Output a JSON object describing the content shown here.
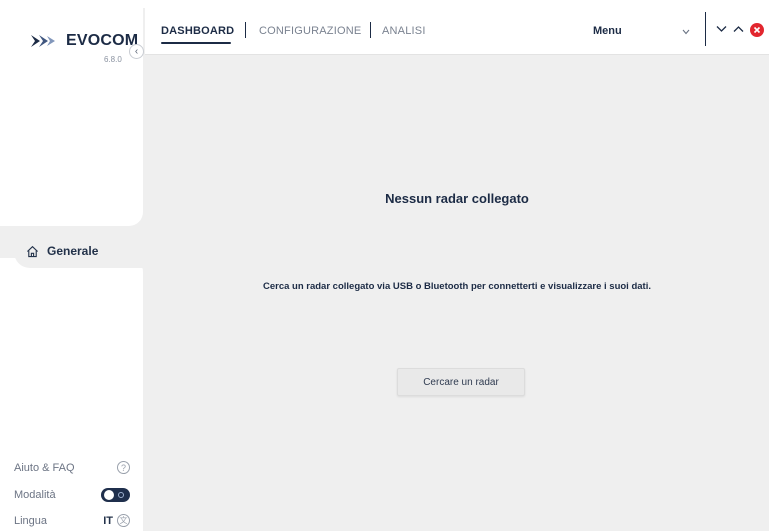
{
  "app": {
    "name": "EVOCOM",
    "version": "6.8.0"
  },
  "header": {
    "tabs": [
      {
        "label": "DASHBOARD",
        "active": true
      },
      {
        "label": "CONFIGURAZIONE",
        "active": false
      },
      {
        "label": "ANALISI",
        "active": false
      }
    ],
    "menu_label": "Menu"
  },
  "sidebar": {
    "collapse_glyph": "‹",
    "nav": [
      {
        "label": "Generale",
        "icon": "home-icon",
        "active": true
      }
    ],
    "footer": {
      "help_label": "Aiuto & FAQ",
      "help_glyph": "?",
      "mode_label": "Modalità",
      "language_label": "Lingua",
      "language_code": "IT",
      "language_glyph": "文"
    }
  },
  "main": {
    "title": "Nessun radar collegato",
    "description": "Cerca un radar collegato via USB o Bluetooth per connetterti e visualizzare i suoi dati.",
    "search_button": "Cercare un radar"
  },
  "colors": {
    "brand_navy": "#1c2b45",
    "close_red": "#e2262e",
    "background": "#efefef"
  }
}
